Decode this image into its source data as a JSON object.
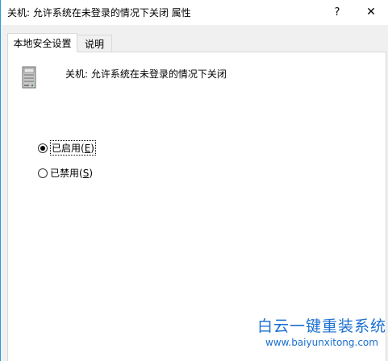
{
  "window": {
    "title": "关机: 允许系统在未登录的情况下关闭 属性",
    "help_glyph": "?",
    "close_glyph": "✕"
  },
  "tabs": [
    {
      "label": "本地安全设置",
      "active": true
    },
    {
      "label": "说明",
      "active": false
    }
  ],
  "policy": {
    "icon": "server-computer-icon",
    "name": "关机: 允许系统在未登录的情况下关闭"
  },
  "options": [
    {
      "label_prefix": "已启用(",
      "mnemonic": "E",
      "label_suffix": ")",
      "checked": true
    },
    {
      "label_prefix": "已禁用(",
      "mnemonic": "S",
      "label_suffix": ")",
      "checked": false
    }
  ],
  "watermark": {
    "title": "白云一键重装系统",
    "url": "www.baiyunxitong.com",
    "color": "#1a6fcf"
  }
}
